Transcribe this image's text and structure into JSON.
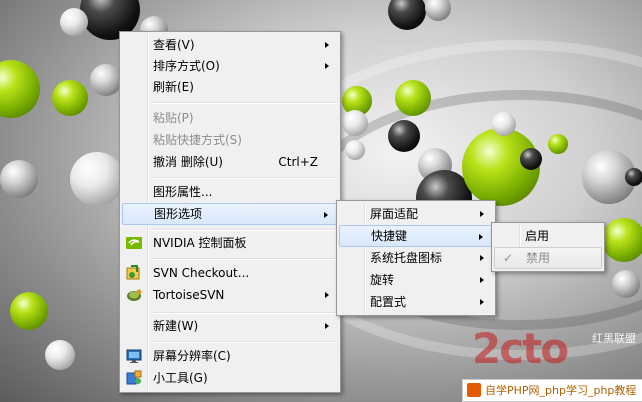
{
  "context_menu": {
    "items": [
      {
        "label": "查看(V)",
        "has_submenu": true
      },
      {
        "label": "排序方式(O)",
        "has_submenu": true
      },
      {
        "label": "刷新(E)"
      },
      {
        "label": "粘贴(P)",
        "disabled": true
      },
      {
        "label": "粘贴快捷方式(S)",
        "disabled": true
      },
      {
        "label": "撤消 删除(U)",
        "shortcut": "Ctrl+Z"
      },
      {
        "label": "图形属性..."
      },
      {
        "label": "图形选项",
        "has_submenu": true,
        "highlighted": true
      },
      {
        "label": "NVIDIA 控制面板",
        "icon": "nvidia-icon"
      },
      {
        "label": "SVN Checkout...",
        "icon": "svn-checkout-icon"
      },
      {
        "label": "TortoiseSVN",
        "icon": "tortoisesvn-icon",
        "has_submenu": true
      },
      {
        "label": "新建(W)",
        "has_submenu": true
      },
      {
        "label": "屏幕分辨率(C)",
        "icon": "display-icon"
      },
      {
        "label": "小工具(G)",
        "icon": "gadgets-icon"
      }
    ]
  },
  "graphics_options_menu": {
    "items": [
      {
        "label": "屏面适配",
        "has_submenu": true
      },
      {
        "label": "快捷键",
        "has_submenu": true,
        "highlighted": true
      },
      {
        "label": "系统托盘图标",
        "has_submenu": true
      },
      {
        "label": "旋转",
        "has_submenu": true
      },
      {
        "label": "配置式",
        "has_submenu": true
      }
    ]
  },
  "hotkey_menu": {
    "items": [
      {
        "label": "启用"
      },
      {
        "label": "禁用",
        "checked": true,
        "check_mark": "✓"
      }
    ]
  },
  "watermark": {
    "logo_text": "2cto",
    "sub_text": "红黑联盟",
    "bar_text": "自学PHP网_php学习_php教程"
  },
  "colors": {
    "menu_bg": "#f0f0f0",
    "highlight": "#d9e8fb",
    "lime_ball": "#8cc800",
    "watermark_red": "#c41a1a"
  }
}
